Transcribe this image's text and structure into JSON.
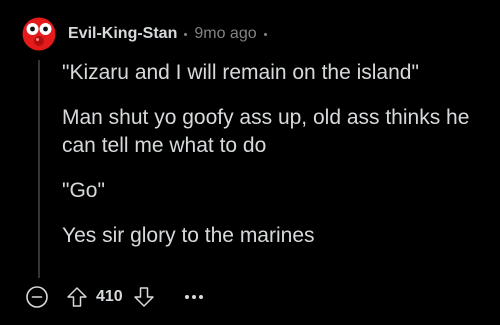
{
  "comment": {
    "username": "Evil-King-Stan",
    "age": "9mo ago",
    "paragraphs": [
      "\"Kizaru and I will remain on the island\"",
      "Man shut yo goofy ass up, old ass thinks he can tell me what to do",
      "\"Go\"",
      "Yes sir glory to the marines"
    ],
    "score": "410"
  },
  "icons": {
    "avatar": "red-face-avatar",
    "collapse": "minus-circle-icon",
    "upvote": "arrow-up-outline-icon",
    "downvote": "arrow-down-outline-icon",
    "more": "more-horizontal-icon"
  },
  "colors": {
    "background": "#000000",
    "text": "#d7dadc",
    "meta": "#818384",
    "thread_line": "#343536",
    "avatar_red": "#e51b1b"
  }
}
